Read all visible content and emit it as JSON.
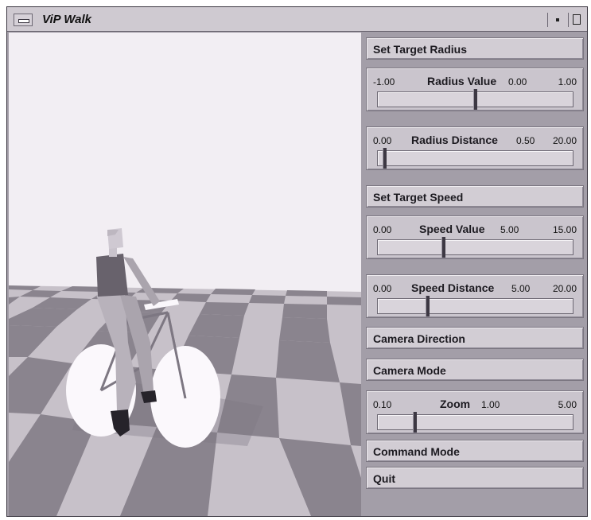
{
  "window": {
    "title": "ViP Walk"
  },
  "panel": {
    "set_target_radius": "Set Target Radius",
    "radius_value": {
      "min": "-1.00",
      "label": "Radius Value",
      "value": "0.00",
      "max": "1.00",
      "fraction": 0.5
    },
    "radius_distance": {
      "min": "0.00",
      "label": "Radius Distance",
      "value": "0.50",
      "max": "20.00",
      "fraction": 0.025
    },
    "set_target_speed": "Set Target Speed",
    "speed_value": {
      "min": "0.00",
      "label": "Speed Value",
      "value": "5.00",
      "max": "15.00",
      "fraction": 0.333
    },
    "speed_distance": {
      "min": "0.00",
      "label": "Speed Distance",
      "value": "5.00",
      "max": "20.00",
      "fraction": 0.25
    },
    "camera_direction": "Camera Direction",
    "camera_mode": "Camera Mode",
    "zoom": {
      "min": "0.10",
      "label": "Zoom",
      "value": "1.00",
      "max": "5.00",
      "fraction": 0.184
    },
    "command_mode": "Command Mode",
    "quit": "Quit"
  },
  "scene": {
    "description_icon": "cyclist-3d-scene",
    "sky_color": "#f2eef3",
    "floor_light": "#c7c1c9",
    "floor_dark": "#8a848e",
    "wheel_color": "#fbf8fc"
  }
}
